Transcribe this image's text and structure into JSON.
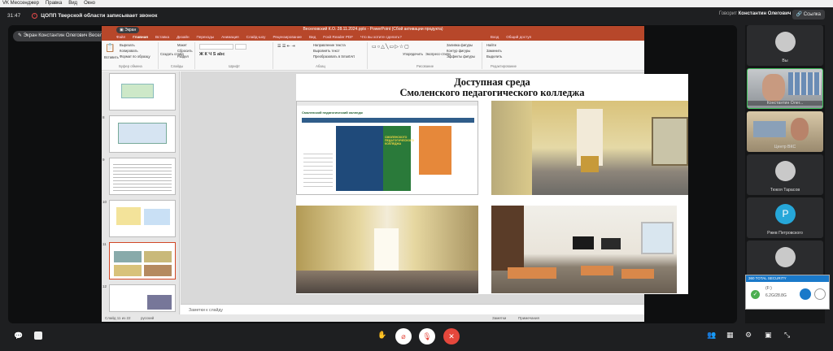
{
  "menubar": {
    "items": [
      "VK Мессенджер",
      "Правка",
      "Вид",
      "Окно"
    ]
  },
  "call": {
    "time": "31:47",
    "recording": "ЦОПП Тверской области записывает звонок",
    "speaking_label": "Говорит",
    "speaking_name": "Константин Олегович В.",
    "link_label": "Ссылка"
  },
  "presenter": {
    "label": "Экран Константин Олегович Веселовский",
    "screen_label": "Экран"
  },
  "ppt": {
    "title": "Веселовский К.О. 28.11.2024.pptx - PowerPoint (Сбой активации продукта)",
    "tabs": [
      "Файл",
      "Главная",
      "Вставка",
      "Дизайн",
      "Переходы",
      "Анимация",
      "Слайд-шоу",
      "Рецензирование",
      "Вид",
      "Foxit Reader PDF",
      "Что вы хотите сделать?",
      "Вход",
      "Общий доступ"
    ],
    "ribbon": {
      "paste": "Вставить",
      "cut": "Вырезать",
      "copy": "Копировать",
      "format_painter": "Формат по образцу",
      "clipboard": "Буфер обмена",
      "new_slide": "Создать слайд",
      "layout": "Макет",
      "reset": "Сбросить",
      "section": "Раздел",
      "slides": "Слайды",
      "font": "Шрифт",
      "paragraph": "Абзац",
      "text_dir": "Направление текста",
      "align_text": "Выровнять текст",
      "smartart": "Преобразовать в SmartArt",
      "drawing": "Рисование",
      "arrange": "Упорядочить",
      "quick_styles": "Экспресс-стили",
      "fill": "Заливка фигуры",
      "outline": "Контур фигуры",
      "effects": "Эффекты фигуры",
      "find": "Найти",
      "replace": "Заменить",
      "select": "Выделить",
      "editing": "Редактирование"
    },
    "thumb_numbers": [
      "8",
      "9",
      "10",
      "11",
      "12"
    ],
    "slide": {
      "title_line1": "Доступная среда",
      "title_line2": "Смоленского педагогического колледжа"
    },
    "site": {
      "name": "Смоленский педагогический колледж",
      "banner": "СМОЛЕНСКОГО ПЕДАГОГИЧЕСКОГО КОЛЛЕДЖА"
    },
    "notes": "Заметки к слайду",
    "status": {
      "slide": "Слайд 11 из 22",
      "lang": "русский",
      "notes": "Заметки",
      "comments": "Примечания"
    }
  },
  "participants": [
    {
      "name": "Вы",
      "type": "avatar"
    },
    {
      "name": "Константин Олег...",
      "type": "video"
    },
    {
      "name": "Центр ВКС",
      "type": "video"
    },
    {
      "name": "Тюкоя Тарасов",
      "type": "avatar"
    },
    {
      "name": "Ржев Петровского",
      "type": "avatar",
      "letter": "Р",
      "color": "#26a7d9"
    },
    {
      "name": "",
      "type": "avatar"
    }
  ],
  "antivirus": {
    "title": "360 TOTAL SECURITY",
    "line1": "(F:)",
    "line2": "6.2G/28.8G"
  },
  "colors": {
    "ppt_accent": "#b7472a",
    "recording": "#e64a4a",
    "hangup": "#e5473c",
    "active_speaker": "#3fbf5b"
  }
}
